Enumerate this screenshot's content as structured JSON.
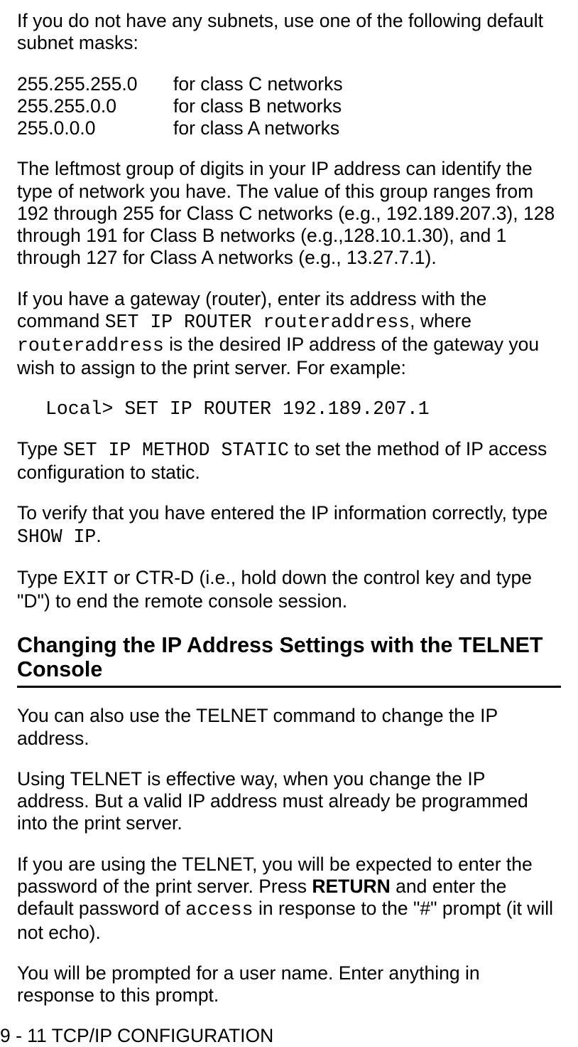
{
  "intro": "If you do not have any subnets, use one of the following default subnet masks:",
  "subnets": [
    {
      "mask": "255.255.255.0",
      "desc": "for class C networks"
    },
    {
      "mask": "255.255.0.0",
      "desc": "for class B networks"
    },
    {
      "mask": "255.0.0.0",
      "desc": "for class A networks"
    }
  ],
  "leftmost": "The leftmost group of digits in your IP address can identify the type of network you have. The value of this group ranges from 192 through 255 for Class C networks (e.g., 192.189.207.3), 128 through 191 for Class B networks (e.g.,128.10.1.30), and 1 through 127 for Class A networks (e.g., 13.27.7.1).",
  "gateway_pre": "If you have a gateway (router), enter its address with the command ",
  "gateway_cmd": "SET IP ROUTER routeraddress",
  "gateway_mid": ", where ",
  "gateway_var": "routeraddress",
  "gateway_post": " is the desired IP address of the gateway you wish to assign to the print server. For example:",
  "router_example": "Local> SET IP ROUTER 192.189.207.1",
  "static_pre": "Type ",
  "static_cmd": "SET IP METHOD STATIC",
  "static_post": " to set the method of IP access configuration to static.",
  "verify_pre": "To verify that you have entered the IP information correctly, type ",
  "verify_cmd": "SHOW IP",
  "verify_post": ".",
  "exit_pre": "Type ",
  "exit_cmd": "EXIT",
  "exit_post": " or CTR-D (i.e., hold down the control key and type \"D\") to end the remote console session.",
  "heading": "Changing the IP Address Settings with the TELNET Console",
  "telnet1": "You can also use the TELNET command to change the IP address.",
  "telnet2": "Using TELNET is effective way, when you change the IP address. But a valid IP address must already be programmed into the print server.",
  "telnet3_pre": "If you are using the TELNET, you will be expected to enter the password of the print server. Press ",
  "telnet3_bold": "RETURN",
  "telnet3_mid": " and enter the default password of ",
  "telnet3_code": "access",
  "telnet3_post": " in response to the \"#\" prompt (it will not echo).",
  "telnet4": "You will be prompted for a user name. Enter anything in response to this prompt.",
  "footer": "9 - 11 TCP/IP CONFIGURATION"
}
